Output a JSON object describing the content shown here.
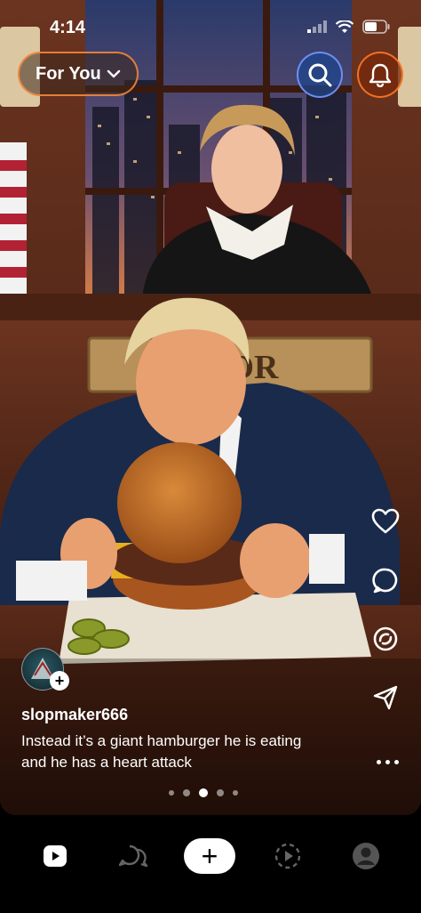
{
  "status_bar": {
    "time": "4:14"
  },
  "header": {
    "feed_label": "For You",
    "search_icon": "search-icon",
    "notifications_icon": "bell-icon"
  },
  "video": {
    "scene_description_icon": "courtroom-video",
    "nameplate_text": "J  UDR"
  },
  "actions": [
    {
      "name": "like",
      "icon": "heart-icon"
    },
    {
      "name": "comment",
      "icon": "comment-icon"
    },
    {
      "name": "remix",
      "icon": "remix-icon"
    },
    {
      "name": "share",
      "icon": "send-icon"
    }
  ],
  "post": {
    "username": "slopmaker666",
    "caption_line1": "Instead it’s a giant hamburger he is eating",
    "caption_line2": "and he has a heart attack"
  },
  "pager": {
    "count": 5,
    "active_index": 2
  },
  "bottom_nav": [
    {
      "name": "home",
      "icon": "home-icon"
    },
    {
      "name": "messages",
      "icon": "chat-icon"
    },
    {
      "name": "create",
      "label": "+"
    },
    {
      "name": "explore",
      "icon": "play-dashed-icon"
    },
    {
      "name": "profile",
      "icon": "person-icon"
    }
  ],
  "colors": {
    "accent_orange": "#ff8c3c",
    "accent_blue": "#7896ff",
    "background": "#000000"
  }
}
